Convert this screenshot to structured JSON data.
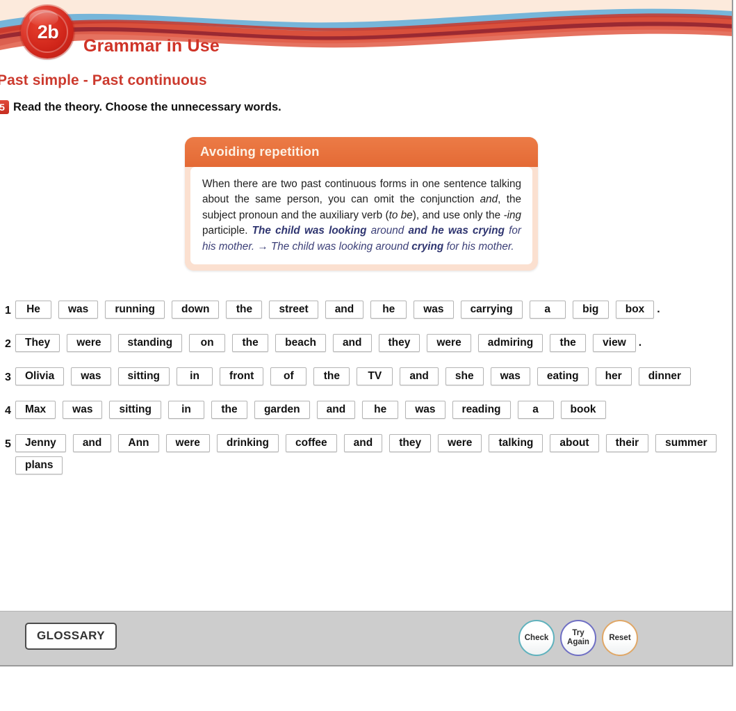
{
  "header": {
    "badge_label": "2b",
    "title": "Grammar in Use",
    "subtitle": "Past simple - Past continuous",
    "title_color": "#cf3327",
    "subtitle_color": "#cc3a2e"
  },
  "instruction": {
    "number": "5",
    "text": "Read the theory. Choose the unnecessary words."
  },
  "theory": {
    "header": "Avoiding repetition",
    "header_color": "#e46a35",
    "text_part_1": "When there are two past continuous forms in one sentence talking about the same person, you can omit the conjunction ",
    "and_italic": "and",
    "text_part_2": ", the subject pronoun and the auxiliary verb (",
    "to_be_italic": "to be",
    "text_part_3": "), and use only the ",
    "ing_italic": "-ing",
    "text_part_4": " participle. ",
    "example_bold_1": "The child was looking",
    "example_plain_1": " around ",
    "example_bold_2": "and he was crying",
    "example_plain_2": " for his mother. ",
    "arrow": "→",
    "example_result_1": "The child was looking around ",
    "example_result_bold": "crying",
    "example_result_2": " for his mother."
  },
  "exercises": [
    {
      "number": "1",
      "words": [
        "He",
        "was",
        "running",
        "down",
        "the",
        "street",
        "and",
        "he",
        "was",
        "carrying",
        "a",
        "big",
        "box"
      ],
      "trailing": "."
    },
    {
      "number": "2",
      "words": [
        "They",
        "were",
        "standing",
        "on",
        "the",
        "beach",
        "and",
        "they",
        "were",
        "admiring",
        "the",
        "view"
      ],
      "trailing": "."
    },
    {
      "number": "3",
      "words": [
        "Olivia",
        "was",
        "sitting",
        "in",
        "front",
        "of",
        "the",
        "TV",
        "and",
        "she",
        "was",
        "eating",
        "her",
        "dinner"
      ],
      "trailing": ""
    },
    {
      "number": "4",
      "words": [
        "Max",
        "was",
        "sitting",
        "in",
        "the",
        "garden",
        "and",
        "he",
        "was",
        "reading",
        "a",
        "book"
      ],
      "trailing": ""
    },
    {
      "number": "5",
      "words": [
        "Jenny",
        "and",
        "Ann",
        "were",
        "drinking",
        "coffee",
        "and",
        "they",
        "were",
        "talking",
        "about",
        "their",
        "summer",
        "plans"
      ],
      "trailing": ""
    }
  ],
  "toolbar": {
    "glossary_label": "GLOSSARY",
    "check_label": "Check",
    "try_again_line1": "Try",
    "try_again_line2": "Again",
    "reset_label": "Reset",
    "check_color": "#5fb2bd",
    "try_again_color": "#6f6fc4",
    "reset_color": "#e0a766"
  }
}
